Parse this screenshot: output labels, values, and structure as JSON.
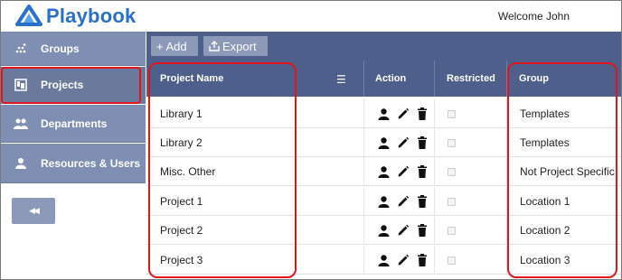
{
  "app": {
    "name": "Playbook",
    "welcome": "Welcome John",
    "brand_color": "#2a6fc9"
  },
  "sidebar": {
    "items": [
      {
        "label": "Groups",
        "icon": "groups-dots-icon"
      },
      {
        "label": "Projects",
        "icon": "projects-icon",
        "active": true
      },
      {
        "label": "Departments",
        "icon": "people-icon"
      },
      {
        "label": "Resources & Users",
        "icon": "person-icon"
      }
    ],
    "collapse_glyph": "◀◀"
  },
  "toolbar": {
    "add_label": "+ Add",
    "export_label": "Export"
  },
  "table": {
    "headers": {
      "project_name": "Project Name",
      "action": "Action",
      "restricted": "Restricted",
      "group": "Group"
    },
    "rows": [
      {
        "name": "Library 1",
        "restricted": false,
        "group": "Templates"
      },
      {
        "name": "Library 2",
        "restricted": false,
        "group": "Templates"
      },
      {
        "name": "Misc. Other",
        "restricted": false,
        "group": "Not Project Specific"
      },
      {
        "name": "Project 1",
        "restricted": false,
        "group": "Location 1"
      },
      {
        "name": "Project 2",
        "restricted": false,
        "group": "Location 2"
      },
      {
        "name": "Project 3",
        "restricted": false,
        "group": "Location 3"
      }
    ]
  },
  "colors": {
    "header_bg": "#4d5f8a",
    "sidebar_bg": "#7f8fb3",
    "highlight": "#e0161e"
  }
}
